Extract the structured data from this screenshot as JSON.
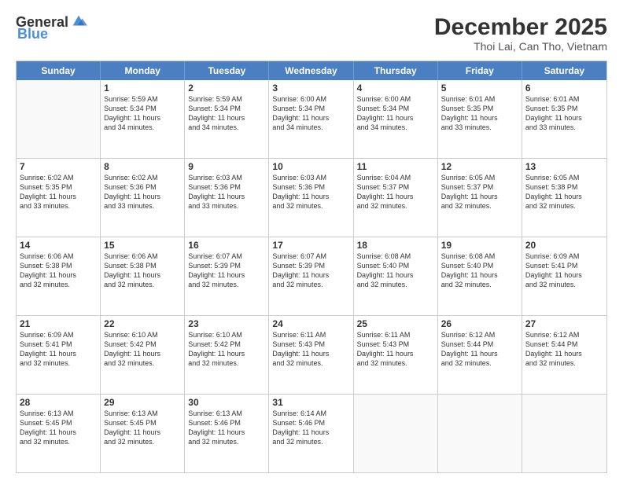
{
  "header": {
    "logo_general": "General",
    "logo_blue": "Blue",
    "month": "December 2025",
    "location": "Thoi Lai, Can Tho, Vietnam"
  },
  "days_of_week": [
    "Sunday",
    "Monday",
    "Tuesday",
    "Wednesday",
    "Thursday",
    "Friday",
    "Saturday"
  ],
  "weeks": [
    [
      {
        "day": "",
        "info": ""
      },
      {
        "day": "1",
        "info": "Sunrise: 5:59 AM\nSunset: 5:34 PM\nDaylight: 11 hours\nand 34 minutes."
      },
      {
        "day": "2",
        "info": "Sunrise: 5:59 AM\nSunset: 5:34 PM\nDaylight: 11 hours\nand 34 minutes."
      },
      {
        "day": "3",
        "info": "Sunrise: 6:00 AM\nSunset: 5:34 PM\nDaylight: 11 hours\nand 34 minutes."
      },
      {
        "day": "4",
        "info": "Sunrise: 6:00 AM\nSunset: 5:34 PM\nDaylight: 11 hours\nand 34 minutes."
      },
      {
        "day": "5",
        "info": "Sunrise: 6:01 AM\nSunset: 5:35 PM\nDaylight: 11 hours\nand 33 minutes."
      },
      {
        "day": "6",
        "info": "Sunrise: 6:01 AM\nSunset: 5:35 PM\nDaylight: 11 hours\nand 33 minutes."
      }
    ],
    [
      {
        "day": "7",
        "info": "Sunrise: 6:02 AM\nSunset: 5:35 PM\nDaylight: 11 hours\nand 33 minutes."
      },
      {
        "day": "8",
        "info": "Sunrise: 6:02 AM\nSunset: 5:36 PM\nDaylight: 11 hours\nand 33 minutes."
      },
      {
        "day": "9",
        "info": "Sunrise: 6:03 AM\nSunset: 5:36 PM\nDaylight: 11 hours\nand 33 minutes."
      },
      {
        "day": "10",
        "info": "Sunrise: 6:03 AM\nSunset: 5:36 PM\nDaylight: 11 hours\nand 32 minutes."
      },
      {
        "day": "11",
        "info": "Sunrise: 6:04 AM\nSunset: 5:37 PM\nDaylight: 11 hours\nand 32 minutes."
      },
      {
        "day": "12",
        "info": "Sunrise: 6:05 AM\nSunset: 5:37 PM\nDaylight: 11 hours\nand 32 minutes."
      },
      {
        "day": "13",
        "info": "Sunrise: 6:05 AM\nSunset: 5:38 PM\nDaylight: 11 hours\nand 32 minutes."
      }
    ],
    [
      {
        "day": "14",
        "info": "Sunrise: 6:06 AM\nSunset: 5:38 PM\nDaylight: 11 hours\nand 32 minutes."
      },
      {
        "day": "15",
        "info": "Sunrise: 6:06 AM\nSunset: 5:38 PM\nDaylight: 11 hours\nand 32 minutes."
      },
      {
        "day": "16",
        "info": "Sunrise: 6:07 AM\nSunset: 5:39 PM\nDaylight: 11 hours\nand 32 minutes."
      },
      {
        "day": "17",
        "info": "Sunrise: 6:07 AM\nSunset: 5:39 PM\nDaylight: 11 hours\nand 32 minutes."
      },
      {
        "day": "18",
        "info": "Sunrise: 6:08 AM\nSunset: 5:40 PM\nDaylight: 11 hours\nand 32 minutes."
      },
      {
        "day": "19",
        "info": "Sunrise: 6:08 AM\nSunset: 5:40 PM\nDaylight: 11 hours\nand 32 minutes."
      },
      {
        "day": "20",
        "info": "Sunrise: 6:09 AM\nSunset: 5:41 PM\nDaylight: 11 hours\nand 32 minutes."
      }
    ],
    [
      {
        "day": "21",
        "info": "Sunrise: 6:09 AM\nSunset: 5:41 PM\nDaylight: 11 hours\nand 32 minutes."
      },
      {
        "day": "22",
        "info": "Sunrise: 6:10 AM\nSunset: 5:42 PM\nDaylight: 11 hours\nand 32 minutes."
      },
      {
        "day": "23",
        "info": "Sunrise: 6:10 AM\nSunset: 5:42 PM\nDaylight: 11 hours\nand 32 minutes."
      },
      {
        "day": "24",
        "info": "Sunrise: 6:11 AM\nSunset: 5:43 PM\nDaylight: 11 hours\nand 32 minutes."
      },
      {
        "day": "25",
        "info": "Sunrise: 6:11 AM\nSunset: 5:43 PM\nDaylight: 11 hours\nand 32 minutes."
      },
      {
        "day": "26",
        "info": "Sunrise: 6:12 AM\nSunset: 5:44 PM\nDaylight: 11 hours\nand 32 minutes."
      },
      {
        "day": "27",
        "info": "Sunrise: 6:12 AM\nSunset: 5:44 PM\nDaylight: 11 hours\nand 32 minutes."
      }
    ],
    [
      {
        "day": "28",
        "info": "Sunrise: 6:13 AM\nSunset: 5:45 PM\nDaylight: 11 hours\nand 32 minutes."
      },
      {
        "day": "29",
        "info": "Sunrise: 6:13 AM\nSunset: 5:45 PM\nDaylight: 11 hours\nand 32 minutes."
      },
      {
        "day": "30",
        "info": "Sunrise: 6:13 AM\nSunset: 5:46 PM\nDaylight: 11 hours\nand 32 minutes."
      },
      {
        "day": "31",
        "info": "Sunrise: 6:14 AM\nSunset: 5:46 PM\nDaylight: 11 hours\nand 32 minutes."
      },
      {
        "day": "",
        "info": ""
      },
      {
        "day": "",
        "info": ""
      },
      {
        "day": "",
        "info": ""
      }
    ]
  ]
}
